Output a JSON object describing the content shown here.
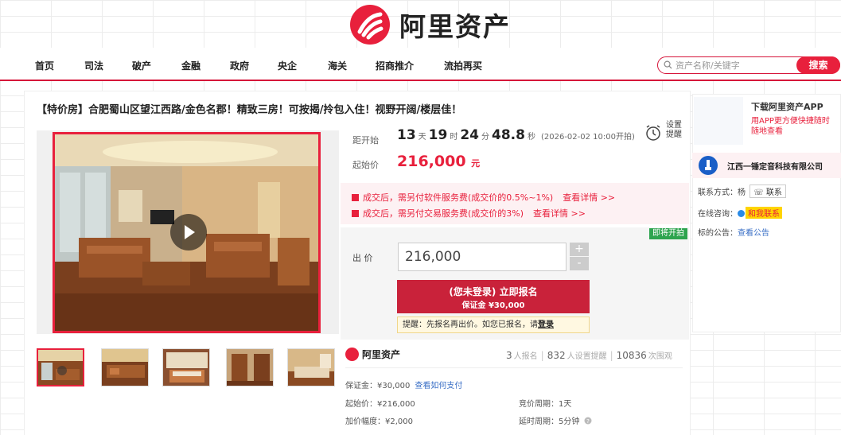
{
  "header": {
    "logo_text": "阿里资产",
    "nav": [
      "首页",
      "司法",
      "破产",
      "金融",
      "政府",
      "央企",
      "海关",
      "招商推介",
      "流拍再买"
    ],
    "search_placeholder": "资产名称/关键字",
    "search_button": "搜索"
  },
  "listing": {
    "title": "【特价房】合肥蜀山区望江西路/金色名郡！精致三房！可按揭/拎包入住！视野开阔/楼层佳！",
    "countdown_label": "距开始",
    "countdown": {
      "days": "13",
      "day_unit": "天",
      "hours": "19",
      "hour_unit": "时",
      "minutes": "24",
      "minute_unit": "分",
      "seconds": "48.8",
      "second_unit": "秒"
    },
    "start_time": "(2026-02-02 10:00开拍)",
    "remind_label": "设置提醒",
    "start_price_label": "起始价",
    "start_price": "216,000",
    "price_unit": "元",
    "fees": [
      {
        "text": "成交后，需另付软件服务费(成交价的0.5%~1%)",
        "link": "查看详情 >>"
      },
      {
        "text": "成交后，需另付交易服务费(成交价的3%)",
        "link": "查看详情 >>"
      }
    ],
    "status_badge": "即将开拍",
    "bid_label": "出 价",
    "bid_value": "216,000",
    "plus": "+",
    "minus": "-",
    "apply_line1": "(您未登录) 立即报名",
    "apply_line2": "保证金 ¥30,000",
    "tip_text": "提醒：先报名再出价。如您已报名，请",
    "tip_link": "登录",
    "brand2": "阿里资产",
    "stats": {
      "signups": "3",
      "signups_unit": "人报名",
      "reminders": "832",
      "reminders_unit": "人设置提醒",
      "views": "10836",
      "views_unit": "次围观"
    },
    "deposit_label": "保证金：¥30,000",
    "deposit_link": "查看如何支付",
    "start_price_row": "起始价：¥216,000",
    "increment_row": "加价幅度：¥2,000",
    "cycle_row": "竞价周期：1天",
    "delay_row": "延时周期：5分钟"
  },
  "sidebar": {
    "app_title": "下载阿里资产APP",
    "app_desc": "用APP更方便快捷随时随地查看",
    "org_name": "江西一锤定音科技有限公司",
    "contact_label": "联系方式：杨",
    "contact_button": "联系",
    "chat_label": "在线咨询：",
    "chat_button": "和我联系",
    "notice_label": "标的公告：",
    "notice_link": "查看公告"
  },
  "colors": {
    "accent": "#e8203c",
    "apply": "#c9223a",
    "link": "#3a6fc6",
    "badge": "#2ea44f"
  }
}
